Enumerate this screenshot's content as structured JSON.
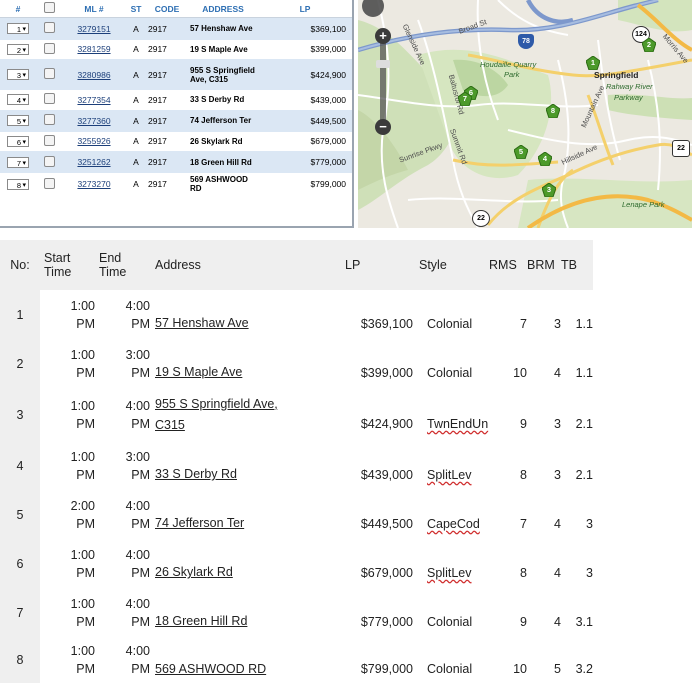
{
  "listing_grid": {
    "columns": [
      "#",
      "",
      "ML #",
      "ST",
      "CODE",
      "ADDRESS",
      "LP"
    ],
    "rows": [
      {
        "sel": "1",
        "ml": "3279151",
        "st": "A",
        "code": "2917",
        "address": "57 Henshaw Ave",
        "lp": "$369,100"
      },
      {
        "sel": "2",
        "ml": "3281259",
        "st": "A",
        "code": "2917",
        "address": "19 S Maple Ave",
        "lp": "$399,000"
      },
      {
        "sel": "3",
        "ml": "3280986",
        "st": "A",
        "code": "2917",
        "address": "955 S Springfield Ave, C315",
        "lp": "$424,900"
      },
      {
        "sel": "4",
        "ml": "3277354",
        "st": "A",
        "code": "2917",
        "address": "33 S Derby Rd",
        "lp": "$439,000"
      },
      {
        "sel": "5",
        "ml": "3277360",
        "st": "A",
        "code": "2917",
        "address": "74 Jefferson Ter",
        "lp": "$449,500"
      },
      {
        "sel": "6",
        "ml": "3255926",
        "st": "A",
        "code": "2917",
        "address": "26 Skylark Rd",
        "lp": "$679,000"
      },
      {
        "sel": "7",
        "ml": "3251262",
        "st": "A",
        "code": "2917",
        "address": "18 Green Hill Rd",
        "lp": "$779,000"
      },
      {
        "sel": "8",
        "ml": "3273270",
        "st": "A",
        "code": "2917",
        "address": "569 ASHWOOD RD",
        "lp": "$799,000"
      }
    ]
  },
  "map": {
    "zoom_in": "+",
    "zoom_out": "−",
    "labels": {
      "broad_st": "Broad St",
      "morris_ave": "Morris Ave",
      "houdaille": "Houdaille Quarry",
      "park": "Park",
      "springfield": "Springfield",
      "rahway": "Rahway River",
      "parkway": "Parkway",
      "lenape": "Lenape Park",
      "mountain_ave": "Mountain Ave",
      "hillside_ave": "Hillside Ave",
      "summit_rd": "Summit Rd",
      "sunrise": "Sunrise Pkwy",
      "baltusrol": "Baltusrol Rd",
      "glenside": "Glenside Ave"
    },
    "shields": {
      "i78": "78",
      "r124": "124",
      "r22": "22",
      "r22b": "22"
    },
    "markers": [
      "1",
      "2",
      "3",
      "4",
      "5",
      "6",
      "7",
      "8"
    ]
  },
  "open_house": {
    "headers": {
      "no": "No:",
      "start": "Start Time",
      "end": "End Time",
      "address": "Address",
      "lp": "LP",
      "style": "Style",
      "rms": "RMS",
      "brm": "BRM",
      "tb": "TB"
    },
    "rows": [
      {
        "no": "1",
        "start_a": "1:00",
        "start_b": "PM",
        "end_a": "4:00",
        "end_b": "PM",
        "addr_a": "57  Henshaw Ave",
        "addr_b": "",
        "lp": "$369,100",
        "style": "Colonial",
        "rms": "7",
        "brm": "3",
        "tb": "1.1"
      },
      {
        "no": "2",
        "start_a": "1:00",
        "start_b": "PM",
        "end_a": "3:00",
        "end_b": "PM",
        "addr_a": "19  S Maple Ave",
        "addr_b": "",
        "lp": "$399,000",
        "style": "Colonial",
        "rms": "10",
        "brm": "4",
        "tb": "1.1"
      },
      {
        "no": "3",
        "start_a": "1:00",
        "start_b": "PM",
        "end_a": "4:00",
        "end_b": "PM",
        "addr_a": "955  S Springfield Ave,",
        "addr_b": "C315",
        "lp": "$424,900",
        "style": "TwnEndUn",
        "rms": "9",
        "brm": "3",
        "tb": "2.1"
      },
      {
        "no": "4",
        "start_a": "1:00",
        "start_b": "PM",
        "end_a": "3:00",
        "end_b": "PM",
        "addr_a": "33  S Derby Rd",
        "addr_b": "",
        "lp": "$439,000",
        "style": "SplitLev",
        "rms": "8",
        "brm": "3",
        "tb": "2.1"
      },
      {
        "no": "5",
        "start_a": "2:00",
        "start_b": "PM",
        "end_a": "4:00",
        "end_b": "PM",
        "addr_a": "74  Jefferson Ter",
        "addr_b": "",
        "lp": "$449,500",
        "style": "CapeCod",
        "rms": "7",
        "brm": "4",
        "tb": "3"
      },
      {
        "no": "6",
        "start_a": "1:00",
        "start_b": "PM",
        "end_a": "4:00",
        "end_b": "PM",
        "addr_a": "26  Skylark Rd",
        "addr_b": "",
        "lp": "$679,000",
        "style": "SplitLev",
        "rms": "8",
        "brm": "4",
        "tb": "3"
      },
      {
        "no": "7",
        "start_a": "1:00",
        "start_b": "PM",
        "end_a": "4:00",
        "end_b": "PM",
        "addr_a": "18  Green Hill Rd",
        "addr_b": "",
        "lp": "$779,000",
        "style": "Colonial",
        "rms": "9",
        "brm": "4",
        "tb": "3.1"
      },
      {
        "no": "8",
        "start_a": "1:00",
        "start_b": "PM",
        "end_a": "4:00",
        "end_b": "PM",
        "addr_a": "569  ASHWOOD RD",
        "addr_b": "",
        "lp": "$799,000",
        "style": "Colonial",
        "rms": "10",
        "brm": "5",
        "tb": "3.2"
      }
    ]
  },
  "colors": {
    "header_blue": "#2e6fb3",
    "row_alt": "#dbe7f4",
    "marker_green": "#4c9a2a",
    "highway_blue": "#6d8fc9"
  }
}
